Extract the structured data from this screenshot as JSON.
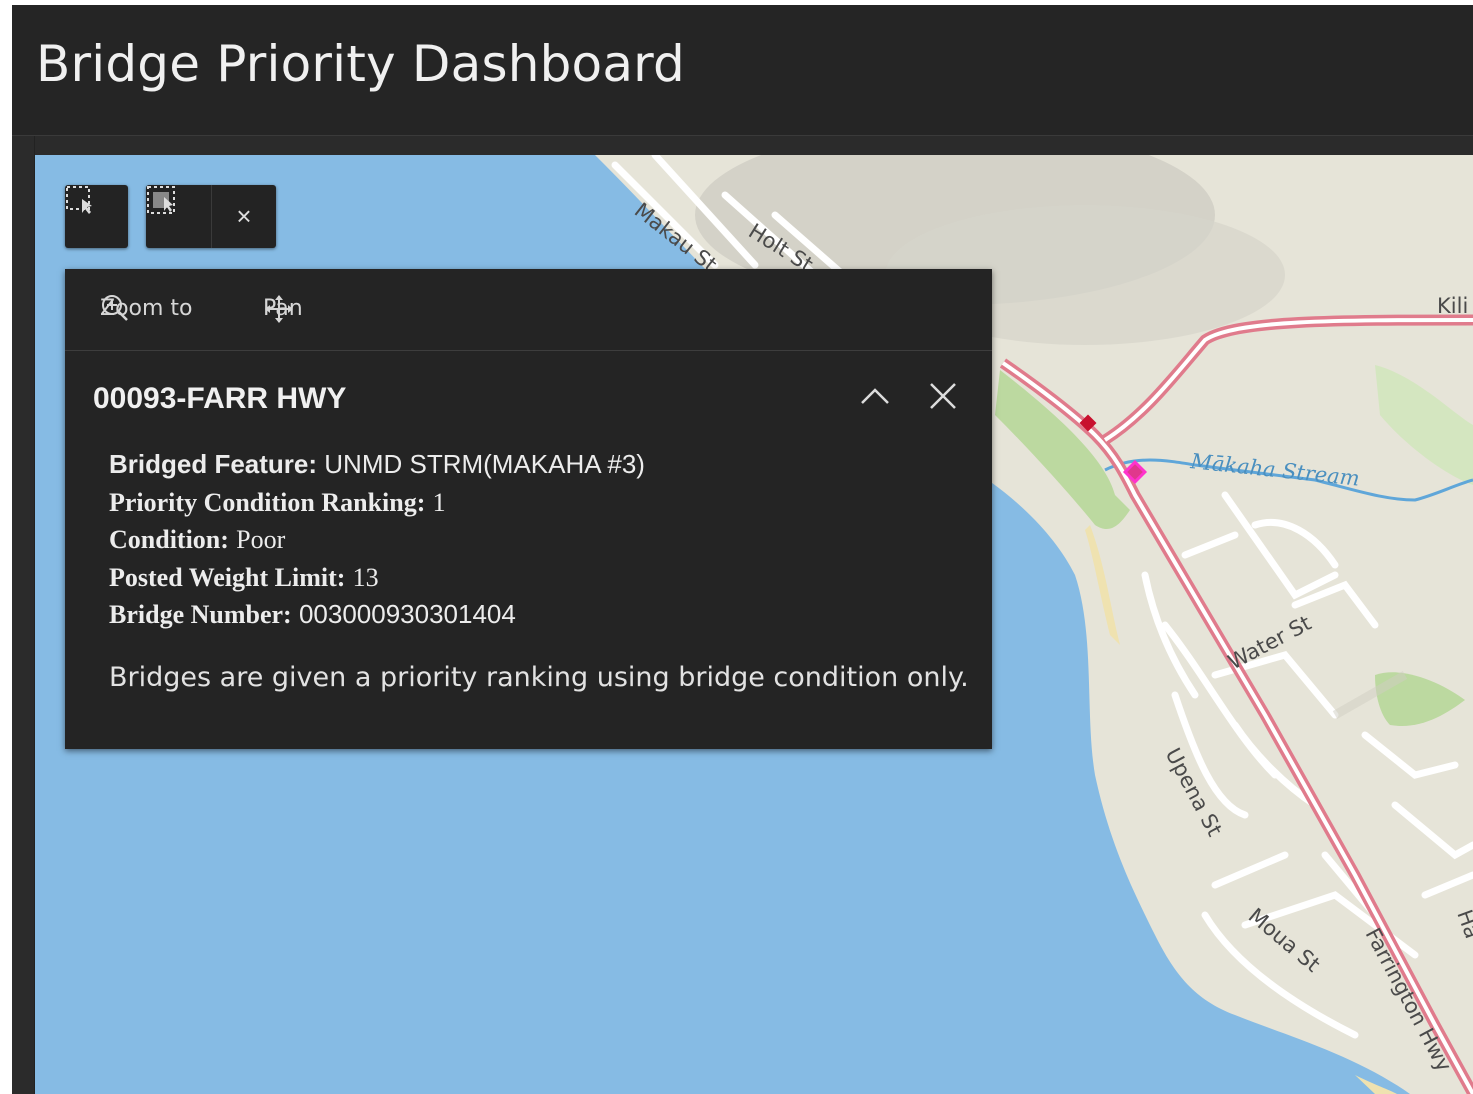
{
  "app": {
    "title": "Bridge Priority Dashboard"
  },
  "map_tools": {
    "select_label": "select-by-rectangle",
    "clear_label": "×"
  },
  "popup": {
    "toolbar": {
      "zoom_label": "Zoom to",
      "pan_label": "Pan"
    },
    "title": "00093-FARR HWY",
    "attributes": [
      {
        "label": "Bridged Feature:",
        "value": "UNMD STRM(MAKAHA #3)"
      },
      {
        "label": "Priority Condition Ranking:",
        "value": "1"
      },
      {
        "label": "Condition:",
        "value": "Poor"
      },
      {
        "label": "Posted Weight Limit:",
        "value": "13"
      },
      {
        "label": "Bridge Number:",
        "value": "003000930301404"
      }
    ],
    "note": "Bridges are given a priority ranking using bridge condition only."
  },
  "map": {
    "labels": {
      "makau": "Makau St",
      "holt": "Holt St",
      "kili": "Kili",
      "makaha_stream": "Mākaha Stream",
      "water": "Water St",
      "upena": "Upena St",
      "moua": "Moua St",
      "farrington": "Farrington Hwy",
      "ha": "Ha"
    },
    "colors": {
      "water": "#86bbe4",
      "land": "#e6e4d8",
      "park": "#bcd9a0",
      "highway": "#e0788a",
      "bridge_marker": "#c8102e",
      "selected_marker": "#ff33cc"
    }
  }
}
